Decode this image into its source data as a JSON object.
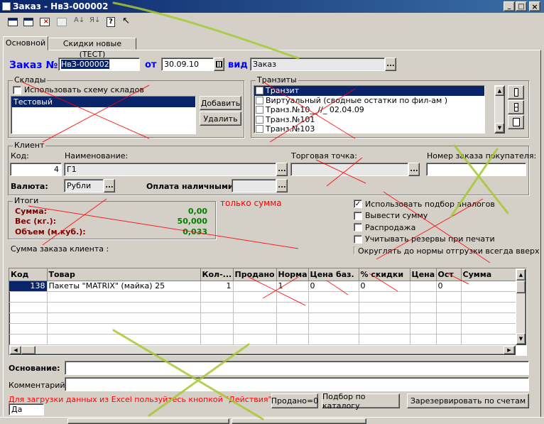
{
  "window": {
    "title": "Заказ - НвЗ-000002",
    "controls": [
      "_",
      "□",
      "×"
    ]
  },
  "toolbar": {
    "icons": [
      "new-doc-icon",
      "copy-doc-icon",
      "delete-doc-icon",
      "mark-delete-icon",
      "sort-asc-icon",
      "sort-desc-icon",
      "help-icon",
      "pointer-help-icon"
    ]
  },
  "tabs": [
    "Основной",
    "Скидки новые (ТЕСТ)"
  ],
  "header": {
    "order_label": "Заказ №",
    "order_no": "НвЗ-000002",
    "date_label": "от",
    "date": "30.09.10",
    "kind_label": "вид",
    "kind": "Заказ"
  },
  "warehouses": {
    "title": "Склады",
    "use_scheme": "Использовать схему складов",
    "items": [
      "Тестовый"
    ],
    "add": "Добавить",
    "remove": "Удалить"
  },
  "transits": {
    "title": "Транзиты",
    "items": [
      "Транзит",
      "Виртуальный (сводные остатки по фил-ам )",
      "Транз.№10__//_ 02.04.09",
      "Транз.№101",
      "Транз.№103"
    ]
  },
  "client": {
    "title": "Клиент",
    "code_label": "Код:",
    "code": "4",
    "name_label": "Наименование:",
    "name": "Г1",
    "outlet_label": "Торговая точка:",
    "outlet": "",
    "buyer_order_label": "Номер заказа покупателя:",
    "buyer_order": "",
    "currency_label": "Валюта:",
    "currency": "Рубли",
    "cash_label": "Оплата наличными:",
    "cash": ""
  },
  "totals": {
    "title": "Итоги",
    "sum_label": "Сумма:",
    "sum": "0,00",
    "weight_label": "Вес (кг.):",
    "weight": "50,000",
    "volume_label": "Объем (м.куб.):",
    "volume": "0,033",
    "only_sum": "только сумма",
    "client_sum_label": "Сумма заказа клиента :"
  },
  "options": [
    {
      "label": "Использовать подбор аналогов",
      "checked": true
    },
    {
      "label": "Вывести сумму",
      "checked": false
    },
    {
      "label": "Распродажа",
      "checked": false
    },
    {
      "label": "Учитывать резервы при печати",
      "checked": false
    },
    {
      "label": "Округлять до нормы отгрузки всегда вверх",
      "checked": false
    }
  ],
  "table": {
    "columns": [
      "Код",
      "Товар",
      "Кол-...",
      "Продано",
      "Норма",
      "Цена баз.",
      "% скидки",
      "Цена",
      "Ост",
      "Сумма"
    ],
    "rows": [
      [
        "138",
        "Пакеты \"MATRIX\" (майка) 25",
        "1",
        "",
        "1",
        "0",
        "0",
        "",
        "0",
        ""
      ]
    ]
  },
  "footer": {
    "basis_label": "Основание:",
    "basis": "",
    "comment_label": "Комментарий:",
    "comment": "",
    "hint": "Для загрузки данных из Excel пользуйтесь кнопкой \"Действия\"",
    "btn_sold": "Продано=0",
    "btn_catalog": "Подбор по каталогу",
    "btn_reserve": "Зарезервировать по счетам",
    "da": "Да"
  },
  "colors": {
    "titlebar": "#0a246a",
    "accent_blue": "#0000ff",
    "dark_red": "#800000",
    "green": "#008000",
    "red": "#ff0000",
    "selection": "#0a246a",
    "annotation_green": "#a8c832"
  }
}
